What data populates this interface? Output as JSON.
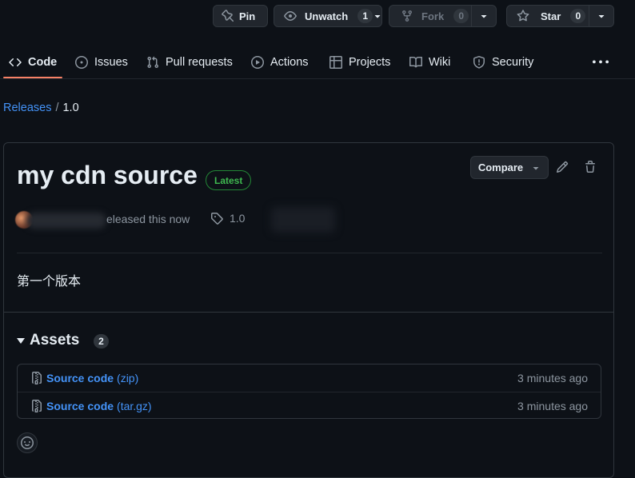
{
  "top_actions": {
    "pin": "Pin",
    "unwatch": "Unwatch",
    "unwatch_count": "1",
    "fork": "Fork",
    "fork_count": "0",
    "star": "Star",
    "star_count": "0"
  },
  "nav": {
    "items": [
      {
        "label": "Code",
        "icon": "code-icon",
        "active": true
      },
      {
        "label": "Issues",
        "icon": "issue-icon"
      },
      {
        "label": "Pull requests",
        "icon": "pull-request-icon"
      },
      {
        "label": "Actions",
        "icon": "play-icon"
      },
      {
        "label": "Projects",
        "icon": "table-icon"
      },
      {
        "label": "Wiki",
        "icon": "book-icon"
      },
      {
        "label": "Security",
        "icon": "shield-icon"
      }
    ],
    "more_icon": "kebab-horizontal-icon"
  },
  "breadcrumb": {
    "releases": "Releases",
    "separator": "/",
    "current": "1.0"
  },
  "release": {
    "title": "my cdn source",
    "badge": "Latest",
    "compare_label": "Compare",
    "released_text": "eleased this now",
    "tag": "1.0",
    "description": "第一个版本",
    "assets_heading": "Assets",
    "assets_count": "2",
    "assets": [
      {
        "name": "Source code",
        "ext": "(zip)",
        "time": "3 minutes ago"
      },
      {
        "name": "Source code",
        "ext": "(tar.gz)",
        "time": "3 minutes ago"
      }
    ]
  },
  "colors": {
    "background": "#0d1117",
    "accent_link": "#4493f8",
    "latest_green": "#3fb950",
    "active_underline": "#f78166"
  }
}
